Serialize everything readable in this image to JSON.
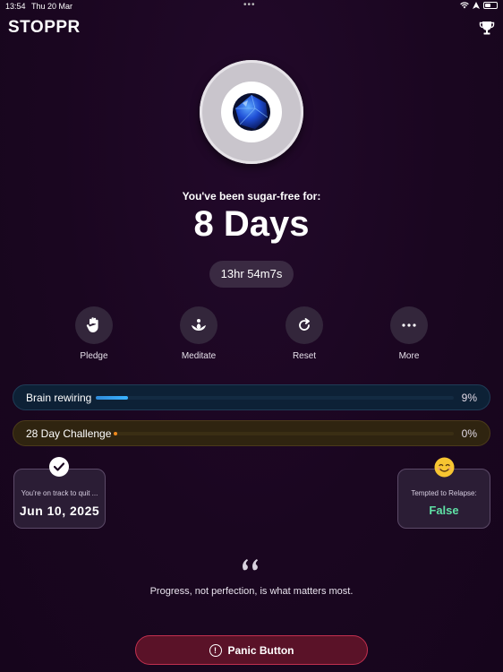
{
  "status_bar": {
    "time": "13:54",
    "date": "Thu 20 Mar",
    "dots": "•••"
  },
  "header": {
    "app_name": "STOPPR",
    "trophy_icon": "trophy-icon"
  },
  "streak": {
    "subtitle": "You've been sugar-free for:",
    "days": "8 Days",
    "timer": "13hr 54m7s"
  },
  "actions": [
    {
      "label": "Pledge",
      "icon": "hand-icon"
    },
    {
      "label": "Meditate",
      "icon": "lotus-icon"
    },
    {
      "label": "Reset",
      "icon": "reset-icon"
    },
    {
      "label": "More",
      "icon": "more-icon"
    }
  ],
  "progress": {
    "brain": {
      "label": "Brain rewiring",
      "percent_text": "9%",
      "fraction": 0.09,
      "color": "#3ab3ff"
    },
    "challenge": {
      "label": "28 Day Challenge",
      "percent_text": "0%",
      "fraction": 0.0,
      "color": "#f08a1e"
    }
  },
  "cards": {
    "track": {
      "caption": "You're on track to quit ...",
      "date": "Jun 10, 2025"
    },
    "relapse": {
      "caption": "Tempted to Relapse:",
      "value": "False",
      "value_color": "#5fe0a5"
    }
  },
  "quote": {
    "text": "Progress, not perfection, is what matters most."
  },
  "panic": {
    "label": "Panic Button",
    "icon_text": "!"
  }
}
